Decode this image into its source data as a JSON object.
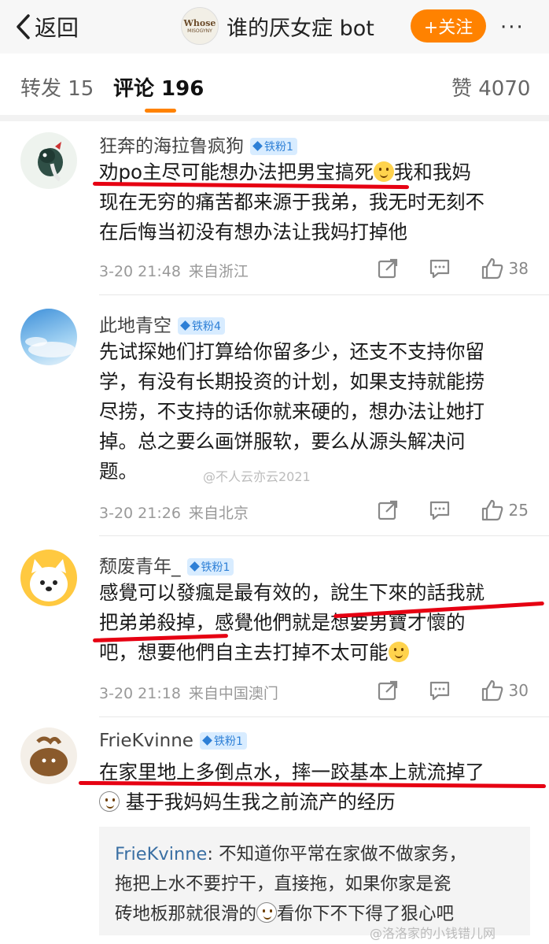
{
  "header": {
    "back_label": "返回",
    "logo_text": "Whose",
    "logo_sub": "MISOGYNY",
    "title": "谁的厌女症 bot",
    "follow_label": "+关注",
    "more": "···"
  },
  "tabs": {
    "repost": "转发 15",
    "comments": "评论 196",
    "likes": "赞 4070"
  },
  "comments": [
    {
      "user": "狂奔的海拉鲁疯狗",
      "badge": "铁粉1",
      "text_a": "劝po主尽可能想办法把男宝搞死",
      "text_b": "我和我妈",
      "text_c": "现在无穷的痛苦都来源于我弟，我无时无刻不",
      "text_d": "在后悔当初没有想办法让我妈打掉他",
      "time": "3-20 21:48",
      "source": "来自浙江",
      "likes": "38"
    },
    {
      "user": "此地青空",
      "badge": "铁粉4",
      "lines": [
        "先试探她们打算给你留多少，还支不支持你留",
        "学，有没有长期投资的计划，如果支持就能捞",
        "尽捞，不支持的话你就来硬的，想办法让她打",
        "掉。总之要么画饼服软，要么从源头解决问",
        "题。"
      ],
      "time": "3-20 21:26",
      "source": "来自北京",
      "likes": "25"
    },
    {
      "user": "颓废青年_",
      "badge": "铁粉1",
      "lines": [
        "感覺可以發瘋是最有效的，說生下來的話我就",
        "把弟弟殺掉，感覺他們就是想要男寶才懷的"
      ],
      "text_e": "吧，想要他們自主去打掉不太可能",
      "time": "3-20 21:18",
      "source": "来自中国澳门",
      "likes": "30"
    },
    {
      "user": "FrieKvinne",
      "badge": "铁粉1",
      "line1": "在家里地上多倒点水，摔一跤基本上就流掉了",
      "line2": "基于我妈妈生我之前流产的经历",
      "reply_name": "FrieKvinne",
      "reply_a": ": 不知道你平常在家做不做家务，",
      "reply_b": "拖把上水不要拧干，直接拖，如果你家是瓷",
      "reply_c": "砖地板那就很滑的",
      "reply_d": "看你下不下得了狠心吧"
    }
  ],
  "watermarks": {
    "mid": "@不人云亦云2021",
    "bottom": "@洛洛家的小钱错儿网"
  },
  "colors": {
    "accent": "#ff8200",
    "underline": "#e60012",
    "badge": "#2d7fd6"
  }
}
